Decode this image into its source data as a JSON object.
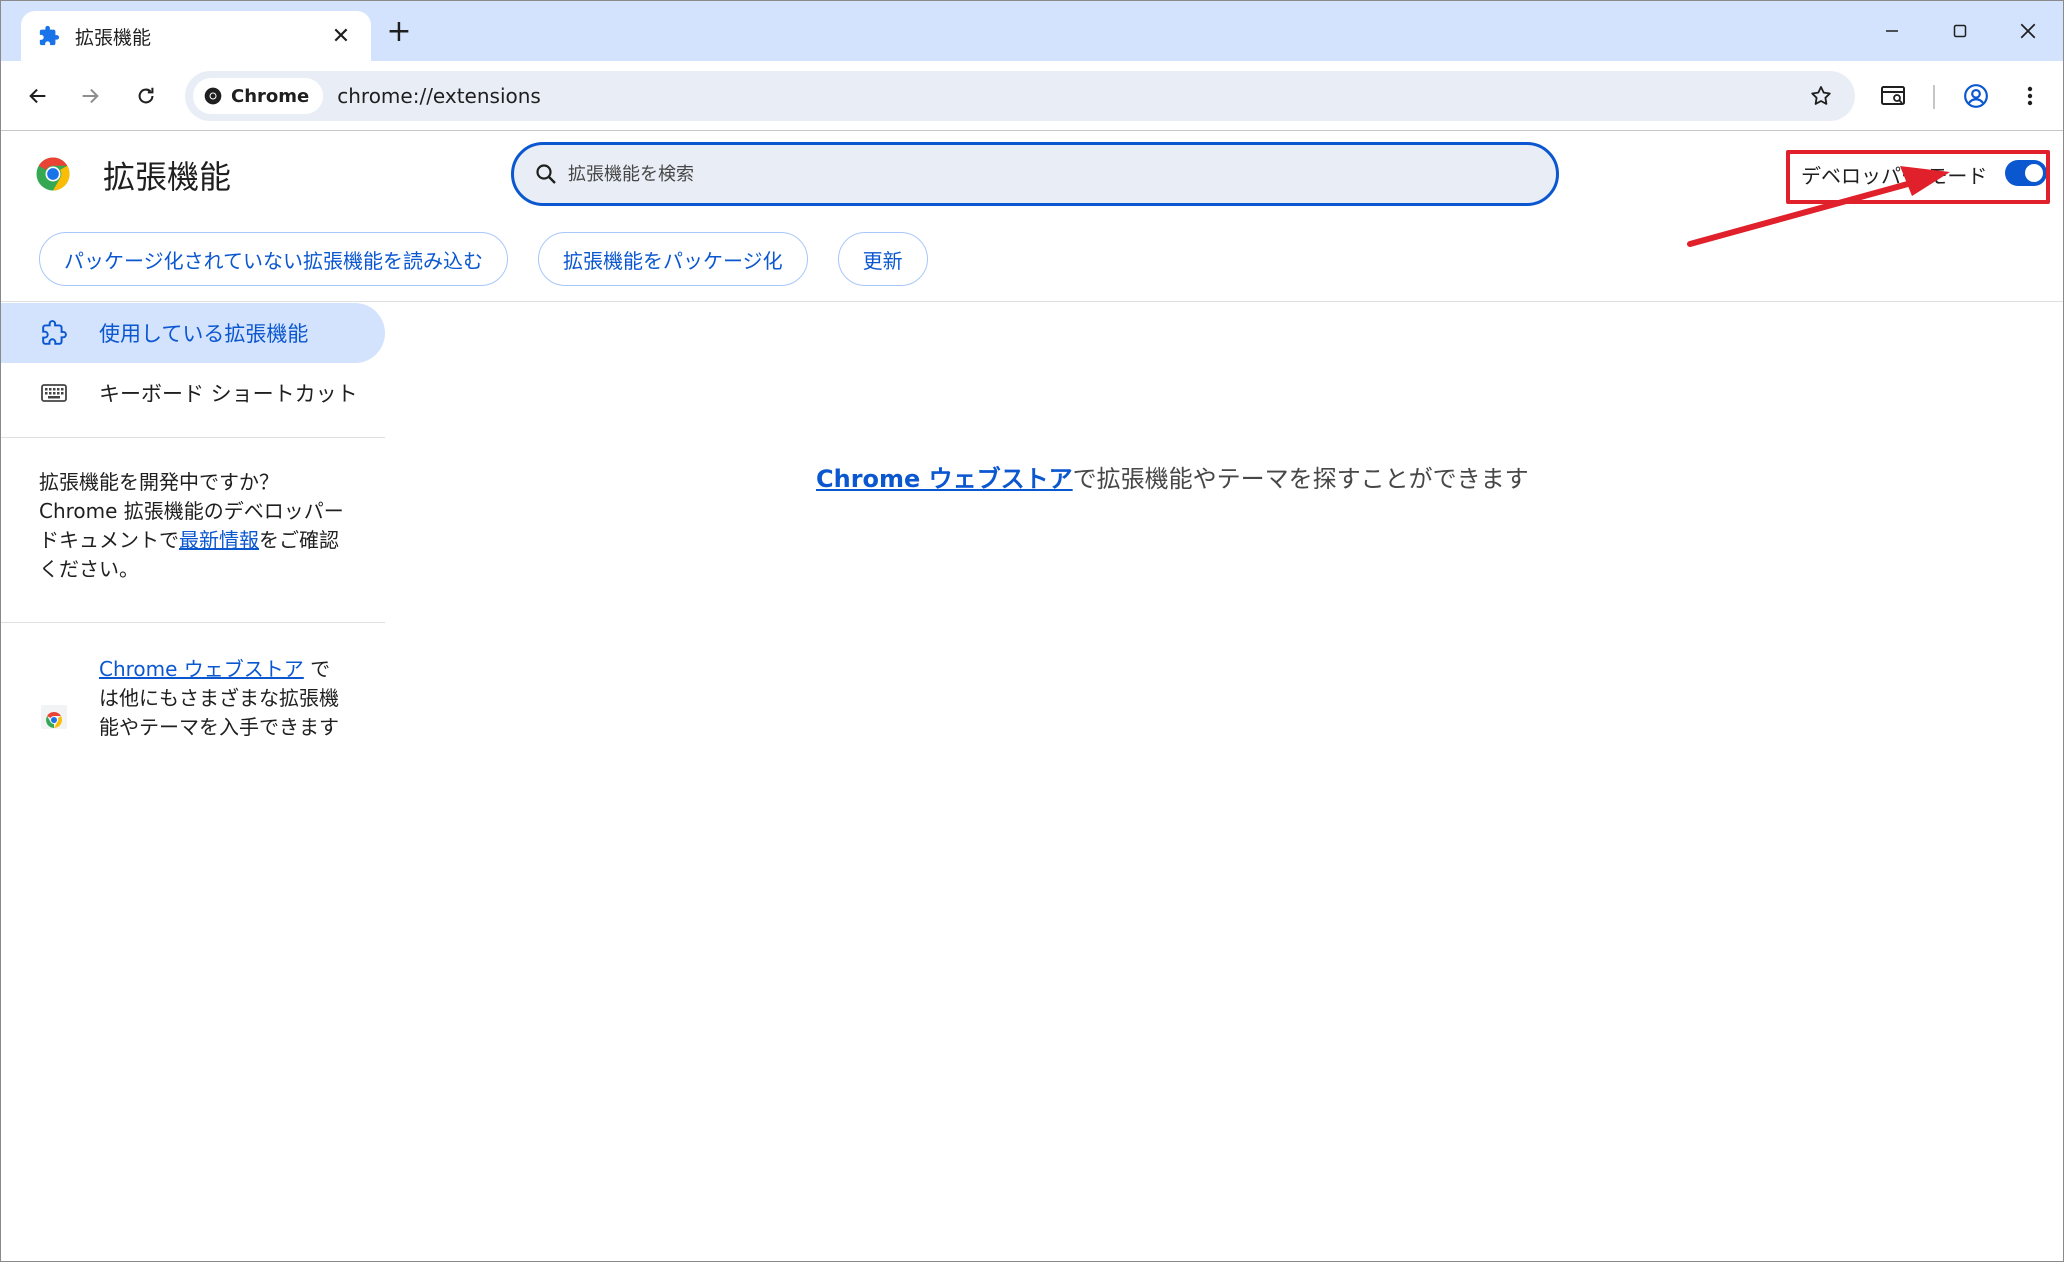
{
  "tab": {
    "title": "拡張機能",
    "close_icon": "close-icon",
    "favicon": "puzzle-icon"
  },
  "toolbar": {
    "chip_label": "Chrome",
    "url": "chrome://extensions"
  },
  "header": {
    "title": "拡張機能",
    "search_placeholder": "拡張機能を検索",
    "dev_mode_label": "デベロッパー モード",
    "dev_mode_on": true,
    "buttons": {
      "load_unpacked": "パッケージ化されていない拡張機能を読み込む",
      "pack": "拡張機能をパッケージ化",
      "update": "更新"
    }
  },
  "sidebar": {
    "items": [
      {
        "label": "使用している拡張機能",
        "active": true
      },
      {
        "label": "キーボード ショートカット",
        "active": false
      }
    ],
    "dev_text": {
      "line_before": "拡張機能を開発中ですか？ Chrome 拡張機能のデベロッパー ドキュメントで",
      "link": "最新情報",
      "line_after": "をご確認ください。"
    },
    "store": {
      "link": "Chrome ウェブストア",
      "text_after": " では他にもさまざまな拡張機能やテーマを入手できます"
    }
  },
  "main": {
    "link": "Chrome ウェブストア",
    "text_after": "で拡張機能やテーマを探すことができます"
  },
  "colors": {
    "accent": "#0b57d0",
    "tabstrip": "#d3e3fd",
    "annotation": "#e0202a"
  }
}
